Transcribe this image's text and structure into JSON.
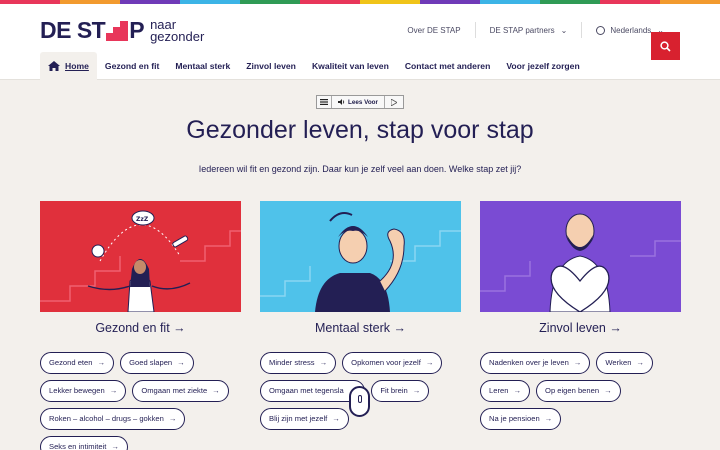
{
  "brand": {
    "logo_main_a": "DE ST",
    "logo_main_b": "P",
    "logo_sub_1": "naar",
    "logo_sub_2": "gezonder"
  },
  "colors": {
    "rainbow": [
      "#e8365a",
      "#f29a2e",
      "#6f3ab8",
      "#3cb4e6",
      "#2f9b55",
      "#e8365a",
      "#f0c419",
      "#6f3ab8",
      "#3cb4e6",
      "#2f9b55",
      "#e8365a",
      "#f29a2e"
    ],
    "accent_red": "#d8212f",
    "red_card": "#e0303c",
    "blue_card": "#4fc2ea",
    "purple_card": "#7a4bd3"
  },
  "top_links": {
    "about": "Over DE STAP",
    "partners": "DE STAP partners",
    "language": "Nederlands"
  },
  "nav": {
    "home": "Home",
    "items": [
      "Gezond en fit",
      "Mentaal sterk",
      "Zinvol leven",
      "Kwaliteit van leven",
      "Contact met anderen",
      "Voor jezelf zorgen"
    ]
  },
  "readbar": {
    "label": "Lees Voor"
  },
  "hero": {
    "title": "Gezonder leven, stap voor stap",
    "intro": "Iedereen wil fit en gezond zijn. Daar kun je zelf veel aan doen. Welke stap zet jij?"
  },
  "columns": [
    {
      "title": "Gezond en fit",
      "tags": [
        "Gezond eten",
        "Goed slapen",
        "Lekker bewegen",
        "Omgaan met ziekte",
        "Roken – alcohol – drugs – gokken",
        "Seks en intimiteit"
      ]
    },
    {
      "title": "Mentaal sterk",
      "tags": [
        "Minder stress",
        "Opkomen voor jezelf",
        "Omgaan met tegensla",
        "Fit brein",
        "Blij zijn met jezelf"
      ]
    },
    {
      "title": "Zinvol leven",
      "tags": [
        "Nadenken over je leven",
        "Werken",
        "Leren",
        "Op eigen benen",
        "Na je pensioen"
      ]
    }
  ],
  "icons": {
    "arrow": "→",
    "chevron": "⌄",
    "zzz": "ZzZ"
  }
}
